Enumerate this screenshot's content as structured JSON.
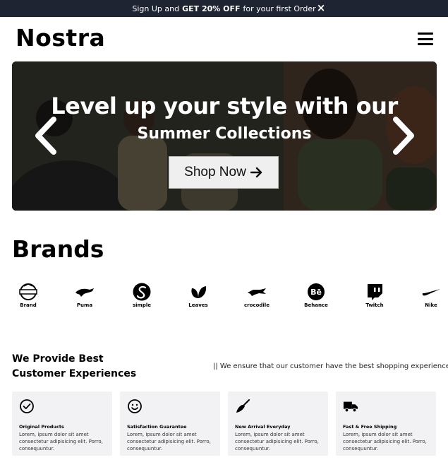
{
  "announcement": {
    "text_before": "Sign Up and",
    "text_bold": "GET 20% OFF",
    "text_after": "for your first Order",
    "close_label": "×"
  },
  "header": {
    "logo": "Nostra",
    "menu_icon": "hamburger-menu-icon"
  },
  "hero": {
    "title_line1": "Level up your style with our",
    "title_line2": "Summer Collections",
    "cta_label": "Shop Now",
    "cta_icon": "arrow-right-icon",
    "prev_icon": "chevron-left-icon",
    "next_icon": "chevron-right-icon"
  },
  "brands": {
    "title": "Brands",
    "items": [
      {
        "name": "Brand",
        "icon": "brand-badge-icon"
      },
      {
        "name": "Puma",
        "icon": "puma-icon"
      },
      {
        "name": "simple",
        "icon": "simple-icon"
      },
      {
        "name": "Leaves",
        "icon": "leaves-icon"
      },
      {
        "name": "crocodile",
        "icon": "crocodile-icon"
      },
      {
        "name": "Behance",
        "icon": "behance-icon"
      },
      {
        "name": "Twitch",
        "icon": "twitch-icon"
      },
      {
        "name": "Nike",
        "icon": "nike-icon"
      }
    ]
  },
  "experience": {
    "title_line1": "We Provide Best",
    "title_line2": "Customer Experiences",
    "subtitle": "|| We ensure that our customer have the best shopping experience",
    "cards": [
      {
        "title": "Original Products",
        "desc": "Lorem, ipsum dolor sit amet consectetur adipisicing elit. Porro, consequuntur.",
        "icon": "check-circle-icon"
      },
      {
        "title": "Satisfaction Guarantee",
        "desc": "Lorem, ipsum dolor sit amet consectetur adipisicing elit. Porro, consequuntur.",
        "icon": "smile-icon"
      },
      {
        "title": "New Arrival Everyday",
        "desc": "Lorem, ipsum dolor sit amet consectetur adipisicing elit. Porro, consequuntur.",
        "icon": "broom-icon"
      },
      {
        "title": "Fast & Free Shipping",
        "desc": "Lorem, ipsum dolor sit amet consectetur adipisicing elit. Porro, consequuntur.",
        "icon": "truck-icon"
      }
    ]
  }
}
